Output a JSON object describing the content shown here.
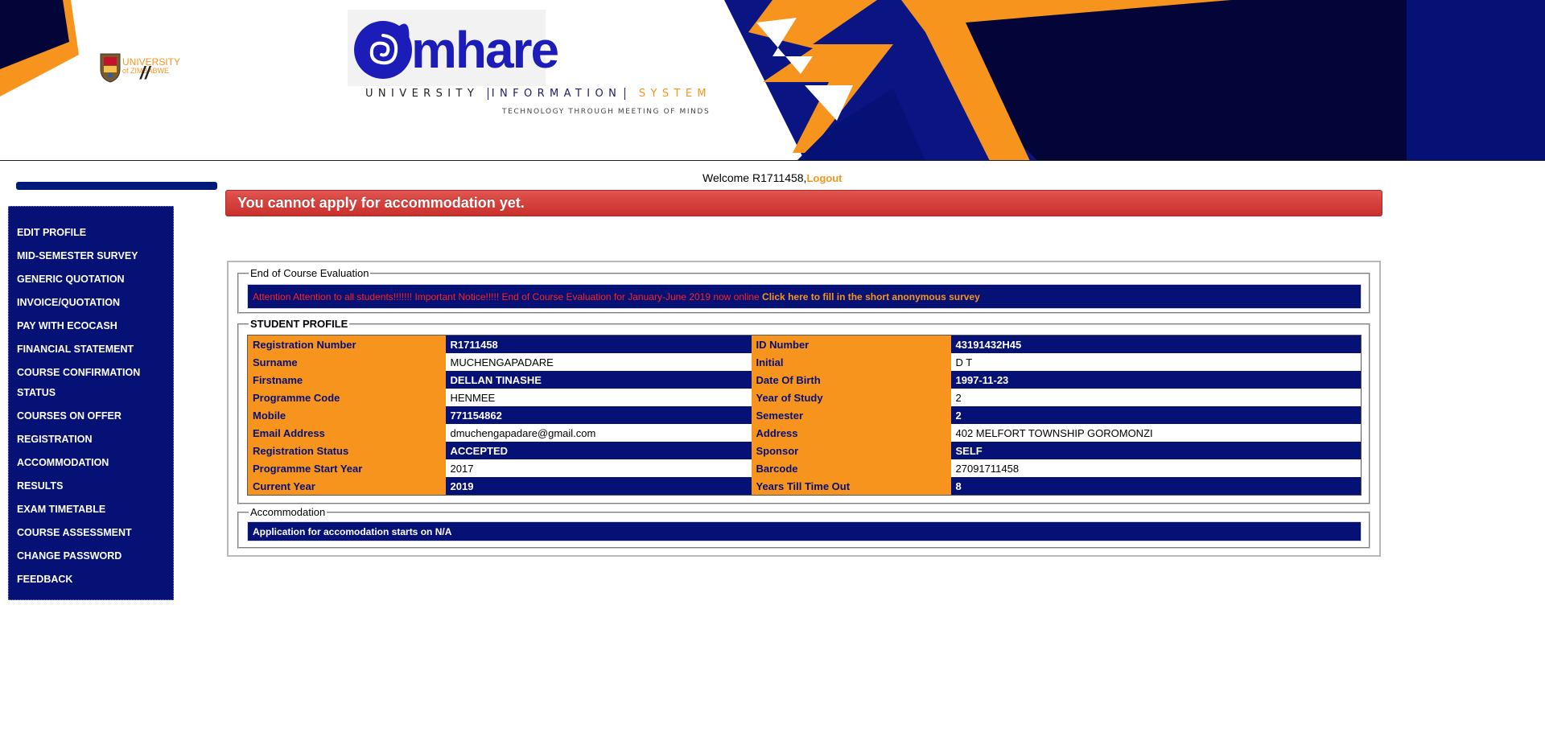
{
  "header": {
    "university_line1": "UNIVERSITY",
    "university_line2": "of ZIMBABWE",
    "brand_word": "mhare",
    "system_word1": "UNIVERSITY",
    "system_word2": "INFORMATION",
    "system_word3": "SYSTEM",
    "tagline": "TECHNOLOGY THROUGH MEETING OF MINDS",
    "colors": {
      "navy": "#061175",
      "orange": "#f7941d",
      "brand_blue": "#1c1db8"
    }
  },
  "sidebar": {
    "items": [
      {
        "label": "EDIT PROFILE"
      },
      {
        "label": "MID-SEMESTER SURVEY"
      },
      {
        "label": "GENERIC QUOTATION"
      },
      {
        "label": "INVOICE/QUOTATION"
      },
      {
        "label": "PAY WITH ECOCASH"
      },
      {
        "label": "FINANCIAL STATEMENT"
      },
      {
        "label": "COURSE CONFIRMATION STATUS"
      },
      {
        "label": "COURSES ON OFFER"
      },
      {
        "label": "REGISTRATION"
      },
      {
        "label": "ACCOMMODATION"
      },
      {
        "label": "RESULTS"
      },
      {
        "label": "EXAM TIMETABLE"
      },
      {
        "label": "COURSE ASSESSMENT"
      },
      {
        "label": "CHANGE PASSWORD"
      },
      {
        "label": "FEEDBACK"
      }
    ]
  },
  "welcome": {
    "text": "Welcome R1711458,",
    "logout_label": "Logout"
  },
  "alert": {
    "message": "You cannot apply for accommodation yet."
  },
  "evaluation": {
    "legend": "End of Course Evaluation",
    "notice": "Attention Attention to all students!!!!!!! Important Notice!!!!! End of Course Evaluation for January-June 2019 now online",
    "link_label": "Click here to fill in the short anonymous survey"
  },
  "profile": {
    "legend": "STUDENT PROFILE",
    "rows": [
      {
        "l1": "Registration Number",
        "v1": "R1711458",
        "l2": "ID Number",
        "v2": "43191432H45"
      },
      {
        "l1": "Surname",
        "v1": "MUCHENGAPADARE",
        "l2": "Initial",
        "v2": "D T"
      },
      {
        "l1": "Firstname",
        "v1": "DELLAN TINASHE",
        "l2": "Date Of Birth",
        "v2": "1997-11-23"
      },
      {
        "l1": "Programme Code",
        "v1": "HENMEE",
        "l2": "Year of Study",
        "v2": "2"
      },
      {
        "l1": "Mobile",
        "v1": "771154862",
        "l2": "Semester",
        "v2": "2"
      },
      {
        "l1": "Email Address",
        "v1": "dmuchengapadare@gmail.com",
        "l2": "Address",
        "v2": "402 MELFORT TOWNSHIP GOROMONZI"
      },
      {
        "l1": "Registration Status",
        "v1": "ACCEPTED",
        "l2": "Sponsor",
        "v2": "SELF"
      },
      {
        "l1": "Programme Start Year",
        "v1": "2017",
        "l2": "Barcode",
        "v2": "27091711458"
      },
      {
        "l1": "Current Year",
        "v1": "2019",
        "l2": "Years Till Time Out",
        "v2": "8"
      }
    ]
  },
  "accommodation": {
    "legend": "Accommodation",
    "message": "Application for accomodation starts on N/A"
  }
}
